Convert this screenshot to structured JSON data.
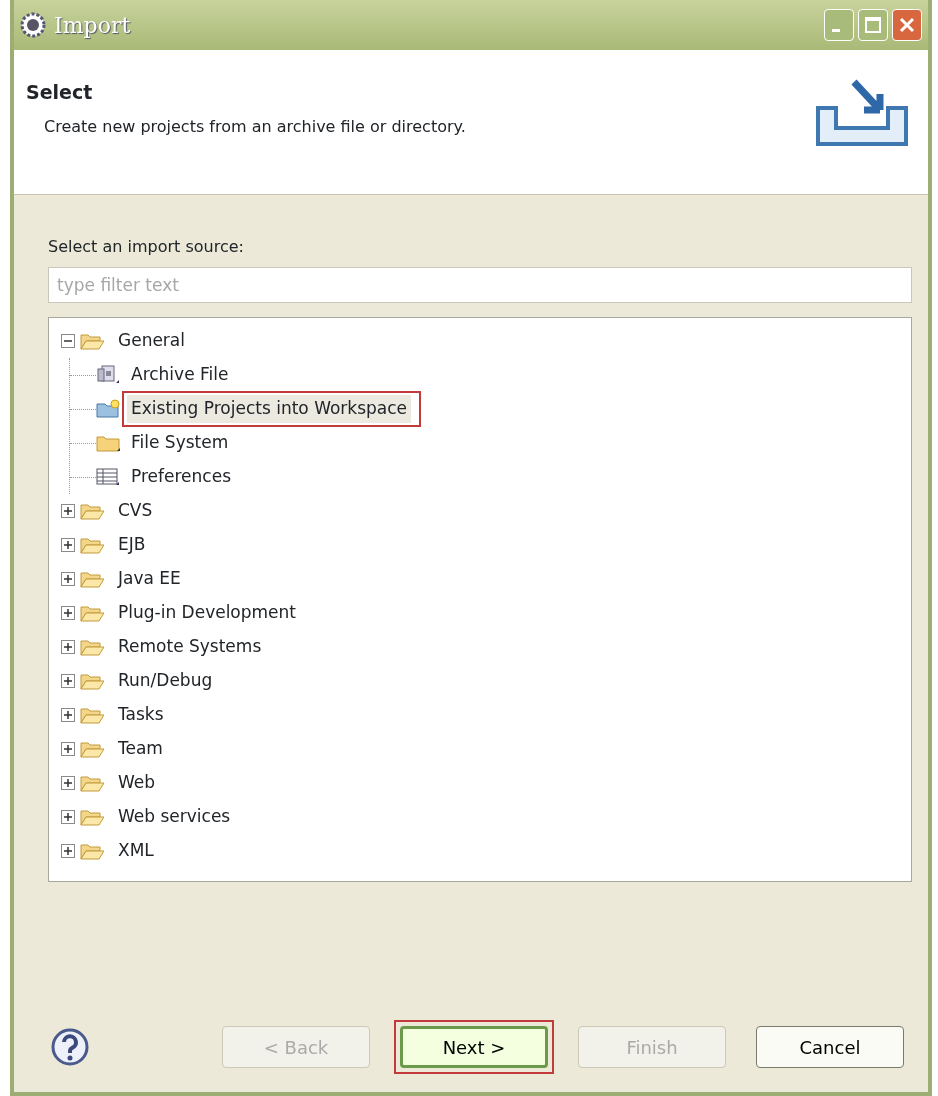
{
  "window": {
    "title": "Import"
  },
  "header": {
    "title": "Select",
    "description": "Create new projects from an archive file or directory."
  },
  "source_label": "Select an import source:",
  "filter": {
    "placeholder": "type filter text"
  },
  "tree": [
    {
      "label": "General",
      "kind": "folder",
      "expanded": true,
      "highlighted": false,
      "children": [
        {
          "label": "Archive File",
          "kind": "archive",
          "highlighted": false
        },
        {
          "label": "Existing Projects into Workspace",
          "kind": "project",
          "highlighted": true,
          "selected": true
        },
        {
          "label": "File System",
          "kind": "folder-closed",
          "highlighted": false
        },
        {
          "label": "Preferences",
          "kind": "table",
          "highlighted": false
        }
      ]
    },
    {
      "label": "CVS",
      "kind": "folder",
      "expanded": false,
      "highlighted": false
    },
    {
      "label": "EJB",
      "kind": "folder",
      "expanded": false,
      "highlighted": false
    },
    {
      "label": "Java EE",
      "kind": "folder",
      "expanded": false,
      "highlighted": false
    },
    {
      "label": "Plug-in Development",
      "kind": "folder",
      "expanded": false,
      "highlighted": false
    },
    {
      "label": "Remote Systems",
      "kind": "folder",
      "expanded": false,
      "highlighted": false
    },
    {
      "label": "Run/Debug",
      "kind": "folder",
      "expanded": false,
      "highlighted": false
    },
    {
      "label": "Tasks",
      "kind": "folder",
      "expanded": false,
      "highlighted": false
    },
    {
      "label": "Team",
      "kind": "folder",
      "expanded": false,
      "highlighted": false
    },
    {
      "label": "Web",
      "kind": "folder",
      "expanded": false,
      "highlighted": false
    },
    {
      "label": "Web services",
      "kind": "folder",
      "expanded": false,
      "highlighted": false
    },
    {
      "label": "XML",
      "kind": "folder",
      "expanded": false,
      "highlighted": false
    }
  ],
  "buttons": [
    {
      "label": "< Back",
      "disabled": true,
      "default": false,
      "highlighted": false
    },
    {
      "label": "Next >",
      "disabled": false,
      "default": true,
      "highlighted": true
    },
    {
      "label": "Finish",
      "disabled": true,
      "default": false,
      "highlighted": false
    },
    {
      "label": "Cancel",
      "disabled": false,
      "default": false,
      "highlighted": false
    }
  ]
}
